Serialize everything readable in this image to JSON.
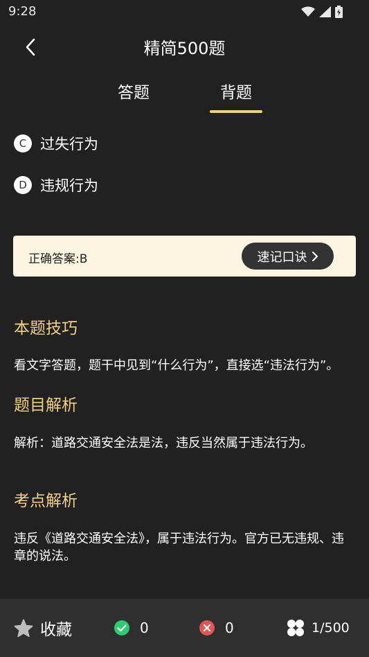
{
  "status_bar": {
    "time": "9:28",
    "icons": [
      "wifi-icon",
      "signal-icon",
      "battery-icon"
    ]
  },
  "nav": {
    "title": "精简500题",
    "back_icon": "chevron-left-icon"
  },
  "tabs": [
    {
      "label": "答题"
    },
    {
      "label": "背题",
      "active": true
    }
  ],
  "options": [
    {
      "letter": "C",
      "text": "过失行为"
    },
    {
      "letter": "D",
      "text": "违规行为"
    }
  ],
  "answer": {
    "text": "正确答案:B",
    "mnemonic_label": "速记口诀"
  },
  "sections": [
    {
      "title": "本题技巧",
      "body": "看文字答题，题干中见到“什么行为”，直接选“违法行为”。"
    },
    {
      "title": "题目解析",
      "body": "解析：道路交通安全法是法，违反当然属于违法行为。"
    },
    {
      "title": "考点解析",
      "body": "违反《道路交通安全法》，属于违法行为。官方已无违规、违章的说法。"
    }
  ],
  "bottom_bar": {
    "favorite_label": "收藏",
    "correct_count": "0",
    "wrong_count": "0",
    "progress": "1/500"
  },
  "colors": {
    "background": "#212121",
    "accent": "#f0cf8c",
    "answer_bg": "#fdf4e1",
    "correct": "#2ecc71",
    "wrong": "#e05555"
  }
}
